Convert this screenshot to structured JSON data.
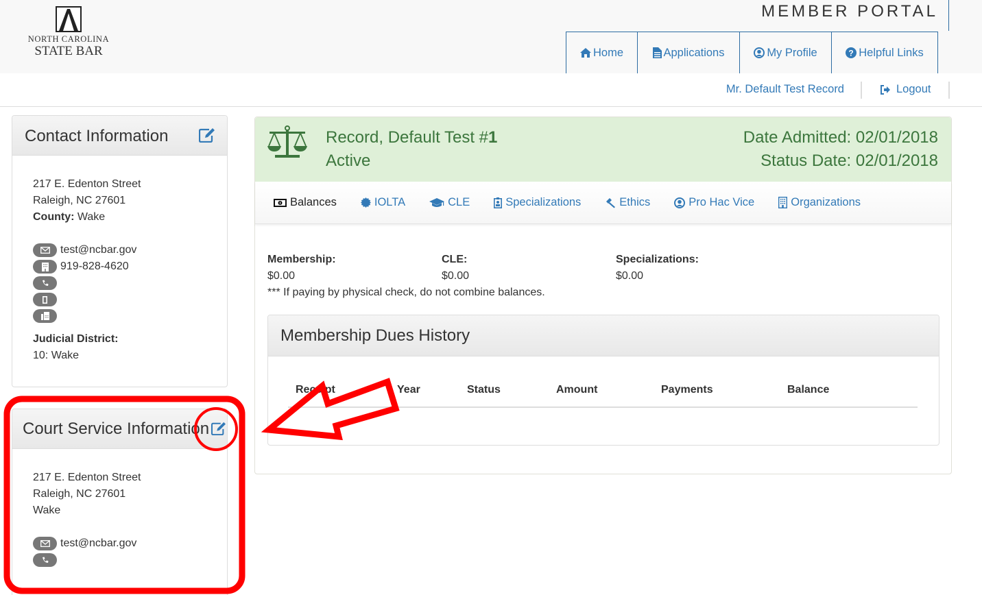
{
  "header": {
    "logo": {
      "line1": "NORTH CAROLINA",
      "line2": "STATE BAR"
    },
    "portal_title": "MEMBER PORTAL",
    "nav": [
      {
        "label": "Home",
        "icon": "home-icon"
      },
      {
        "label": "Applications",
        "icon": "file-icon"
      },
      {
        "label": "My Profile",
        "icon": "user-circle-icon"
      },
      {
        "label": "Helpful Links",
        "icon": "question-circle-icon"
      }
    ],
    "user_name": "Mr. Default Test Record",
    "logout_label": "Logout"
  },
  "contact": {
    "title": "Contact Information",
    "address1": "217 E. Edenton Street",
    "address2": "Raleigh, NC 27601",
    "county_label": "County:",
    "county_value": "Wake",
    "email": "test@ncbar.gov",
    "office_phone": "919-828-4620",
    "phone": "",
    "mobile": "",
    "fax": "",
    "judicial_label": "Judicial District:",
    "judicial_value": "10: Wake"
  },
  "court_service": {
    "title": "Court Service Information",
    "address1": "217 E. Edenton Street",
    "address2": "Raleigh, NC 27601",
    "county": "Wake",
    "email": "test@ncbar.gov",
    "phone": ""
  },
  "record": {
    "name": "Record, Default Test #",
    "number": "1",
    "status": "Active",
    "date_admitted": "Date Admitted: 02/01/2018",
    "status_date": "Status Date: 02/01/2018",
    "colors": {
      "success_bg": "#dff0d8",
      "success_text": "#3c763d"
    }
  },
  "tabs": [
    {
      "label": "Balances",
      "icon": "money-icon",
      "active": true
    },
    {
      "label": "IOLTA",
      "icon": "certificate-icon",
      "active": false
    },
    {
      "label": "CLE",
      "icon": "graduation-cap-icon",
      "active": false
    },
    {
      "label": "Specializations",
      "icon": "id-badge-icon",
      "active": false
    },
    {
      "label": "Ethics",
      "icon": "gavel-icon",
      "active": false
    },
    {
      "label": "Pro Hac Vice",
      "icon": "user-circle-icon",
      "active": false
    },
    {
      "label": "Organizations",
      "icon": "building-icon",
      "active": false
    }
  ],
  "balances": {
    "items": [
      {
        "label": "Membership:",
        "value": "$0.00"
      },
      {
        "label": "CLE:",
        "value": "$0.00"
      },
      {
        "label": "Specializations:",
        "value": "$0.00"
      }
    ],
    "note": "*** If paying by physical check, do not combine balances."
  },
  "dues_history": {
    "title": "Membership Dues History",
    "columns": [
      "Receipt",
      "Year",
      "Status",
      "Amount",
      "Payments",
      "Balance"
    ],
    "rows": []
  },
  "annotation": {
    "color": "#ff0000",
    "target": "court-service-edit-icon"
  }
}
